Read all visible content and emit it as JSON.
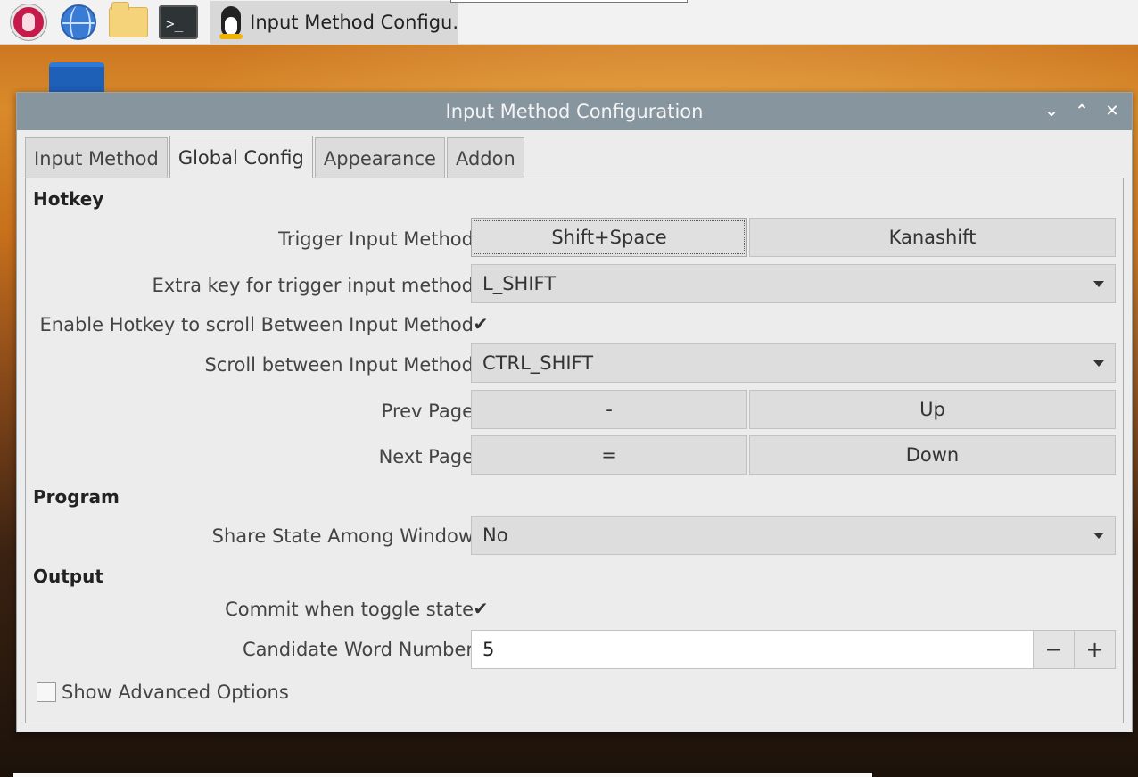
{
  "taskbar": {
    "launchers": [
      {
        "icon": "raspberry-pi-menu-icon"
      },
      {
        "icon": "web-browser-icon"
      },
      {
        "icon": "file-manager-icon"
      },
      {
        "icon": "terminal-icon",
        "glyph": ">_"
      }
    ],
    "app_button_label": "Input Method Configu...",
    "app_icon": "tux-penguin-icon"
  },
  "desktop": {
    "trash_icon": "trash-icon"
  },
  "window": {
    "title": "Input Method Configuration",
    "controls": {
      "minimize": "⌄",
      "maximize": "⌃",
      "close": "✕"
    }
  },
  "tabs": [
    "Input Method",
    "Global Config",
    "Appearance",
    "Addon"
  ],
  "active_tab": "Global Config",
  "hotkey": {
    "section": "Hotkey",
    "trigger_label": "Trigger Input Method",
    "trigger_key1": "Shift+Space",
    "trigger_key2": "Kanashift",
    "extra_key_label": "Extra key for trigger input method",
    "extra_key_value": "L_SHIFT",
    "enable_scroll_label": "Enable Hotkey to scroll Between Input Method",
    "enable_scroll_checked": true,
    "scroll_label": "Scroll between Input Method",
    "scroll_value": "CTRL_SHIFT",
    "prev_page_label": "Prev Page",
    "prev_key1": "-",
    "prev_key2": "Up",
    "next_page_label": "Next Page",
    "next_key1": "=",
    "next_key2": "Down"
  },
  "program": {
    "section": "Program",
    "share_state_label": "Share State Among Window",
    "share_state_value": "No"
  },
  "output": {
    "section": "Output",
    "commit_label": "Commit when toggle state",
    "commit_checked": true,
    "candidate_label": "Candidate Word Number",
    "candidate_value": "5",
    "minus": "−",
    "plus": "+"
  },
  "advanced": {
    "label": "Show Advanced Options",
    "checked": false
  },
  "checkmark": "✔"
}
